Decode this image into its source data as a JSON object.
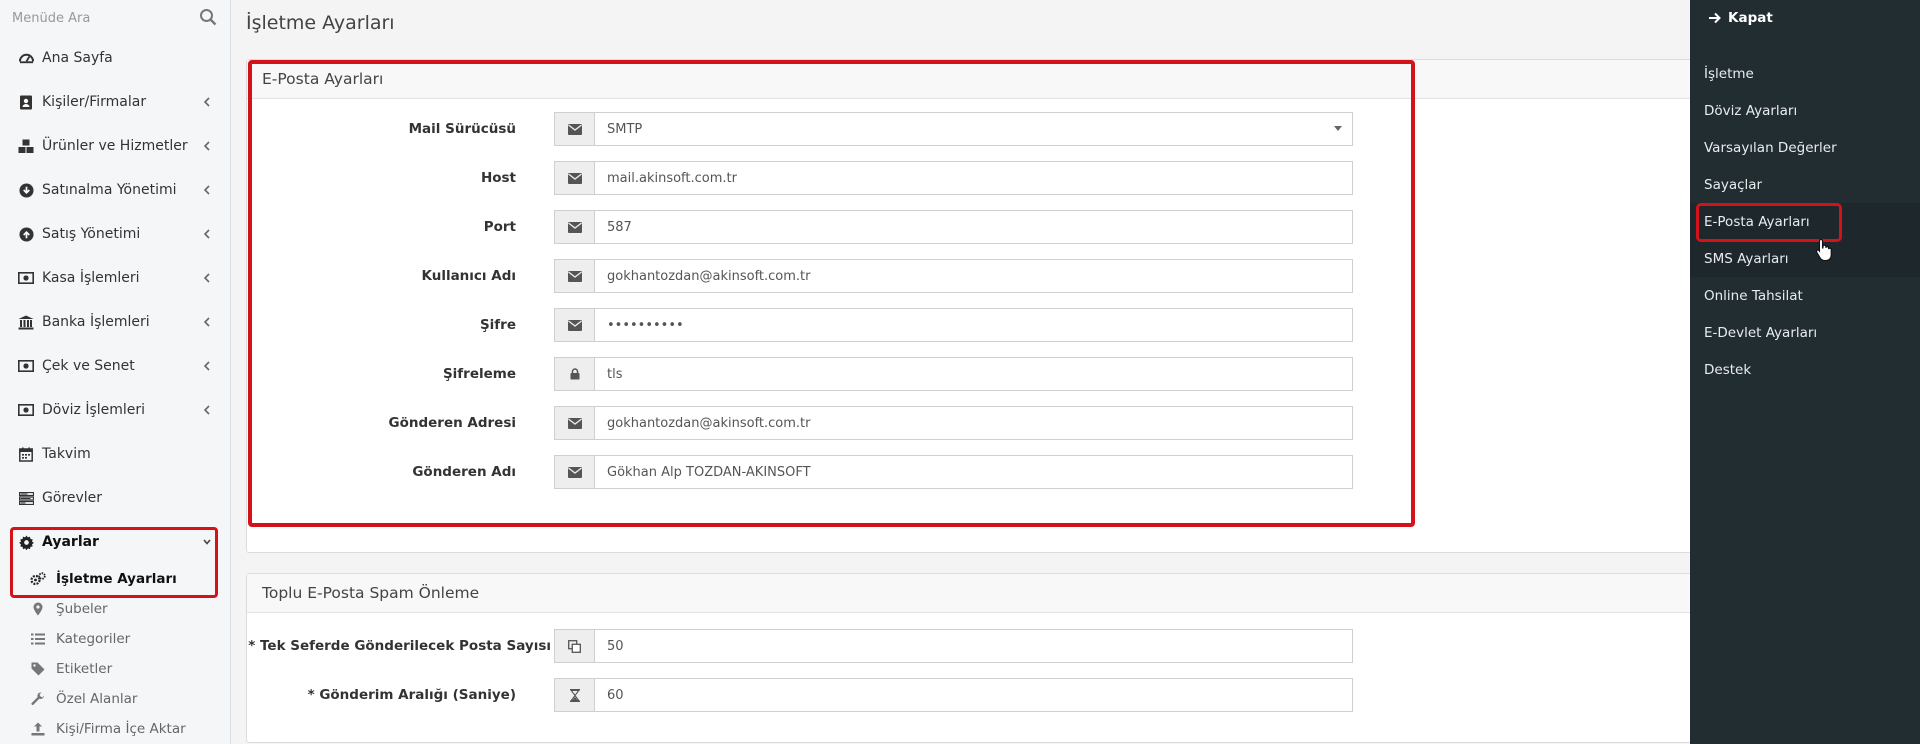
{
  "sidebar": {
    "search_placeholder": "Menüde Ara",
    "items": [
      {
        "label": "Ana Sayfa",
        "icon": "dashboard-icon"
      },
      {
        "label": "Kişiler/Firmalar",
        "icon": "address-book-icon"
      },
      {
        "label": "Ürünler ve Hizmetler",
        "icon": "cubes-icon"
      },
      {
        "label": "Satınalma Yönetimi",
        "icon": "arrow-circle-down-icon"
      },
      {
        "label": "Satış Yönetimi",
        "icon": "arrow-circle-up-icon"
      },
      {
        "label": "Kasa İşlemleri",
        "icon": "money-icon"
      },
      {
        "label": "Banka İşlemleri",
        "icon": "bank-icon"
      },
      {
        "label": "Çek ve Senet",
        "icon": "money-icon"
      },
      {
        "label": "Döviz İşlemleri",
        "icon": "money-icon"
      },
      {
        "label": "Takvim",
        "icon": "calendar-icon"
      },
      {
        "label": "Görevler",
        "icon": "tasks-icon"
      },
      {
        "label": "Ayarlar",
        "icon": "gear-icon"
      }
    ],
    "sub_items": [
      {
        "label": "İşletme Ayarları",
        "icon": "gears-icon"
      },
      {
        "label": "Şubeler",
        "icon": "map-marker-icon"
      },
      {
        "label": "Kategoriler",
        "icon": "list-icon"
      },
      {
        "label": "Etiketler",
        "icon": "tag-icon"
      },
      {
        "label": "Özel Alanlar",
        "icon": "wrench-icon"
      },
      {
        "label": "Kişi/Firma İçe Aktar",
        "icon": "upload-icon"
      }
    ]
  },
  "page": {
    "title": "İşletme Ayarları"
  },
  "email_panel": {
    "title": "E-Posta Ayarları",
    "fields": [
      {
        "label": "Mail Sürücüsü",
        "value": "SMTP",
        "icon": "envelope-icon"
      },
      {
        "label": "Host",
        "value": "mail.akinsoft.com.tr",
        "icon": "envelope-icon"
      },
      {
        "label": "Port",
        "value": "587",
        "icon": "envelope-icon"
      },
      {
        "label": "Kullanıcı Adı",
        "value": "gokhantozdan@akinsoft.com.tr",
        "icon": "envelope-icon"
      },
      {
        "label": "Şifre",
        "value": "••••••••••",
        "icon": "envelope-icon"
      },
      {
        "label": "Şifreleme",
        "value": "tls",
        "icon": "lock-icon"
      },
      {
        "label": "Gönderen Adresi",
        "value": "gokhantozdan@akinsoft.com.tr",
        "icon": "envelope-icon"
      },
      {
        "label": "Gönderen Adı",
        "value": "Gökhan Alp TOZDAN-AKINSOFT",
        "icon": "envelope-icon"
      }
    ]
  },
  "spam_panel": {
    "title": "Toplu E-Posta Spam Önleme",
    "fields": [
      {
        "label": "* Tek Seferde Gönderilecek Posta Sayısı",
        "value": "50",
        "icon": "copy-icon"
      },
      {
        "label": "* Gönderim Aralığı (Saniye)",
        "value": "60",
        "icon": "hourglass-icon"
      }
    ]
  },
  "right_panel": {
    "close_label": "Kapat",
    "items": [
      {
        "label": "İşletme"
      },
      {
        "label": "Döviz Ayarları"
      },
      {
        "label": "Varsayılan Değerler"
      },
      {
        "label": "Sayaçlar"
      },
      {
        "label": "E-Posta Ayarları"
      },
      {
        "label": "SMS Ayarları"
      },
      {
        "label": "Online Tahsilat"
      },
      {
        "label": "E-Devlet Ayarları"
      },
      {
        "label": "Destek"
      }
    ]
  },
  "colors": {
    "highlight": "#d4121a",
    "right_panel_bg": "#222d32",
    "sidebar_bg": "#f4f6f8"
  }
}
